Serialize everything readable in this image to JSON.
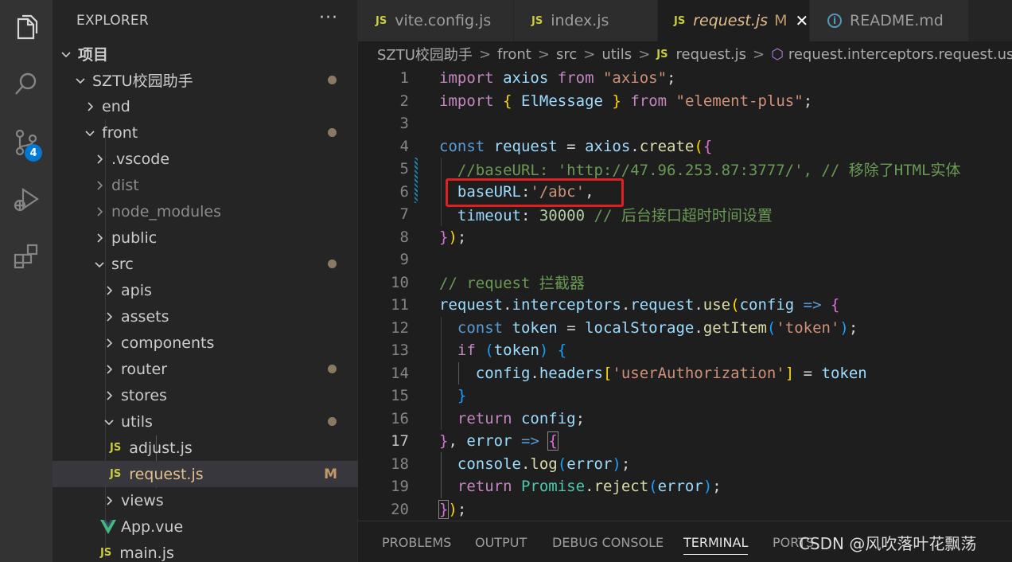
{
  "activity_bar": {
    "items": [
      {
        "icon": "files-icon"
      },
      {
        "icon": "search-icon"
      },
      {
        "icon": "source-control-icon",
        "badge": "4"
      },
      {
        "icon": "run-debug-icon"
      },
      {
        "icon": "extensions-icon"
      }
    ]
  },
  "sidebar": {
    "title": "EXPLORER",
    "more": "···",
    "tree": [
      {
        "label": "项目",
        "bold": true
      },
      {
        "label": "SZTU校园助手"
      },
      {
        "label": "end"
      },
      {
        "label": "front"
      },
      {
        "label": ".vscode"
      },
      {
        "label": "dist"
      },
      {
        "label": "node_modules"
      },
      {
        "label": "public"
      },
      {
        "label": "src"
      },
      {
        "label": "apis"
      },
      {
        "label": "assets"
      },
      {
        "label": "components"
      },
      {
        "label": "router"
      },
      {
        "label": "stores"
      },
      {
        "label": "utils"
      },
      {
        "label": "adjust.js"
      },
      {
        "label": "request.js",
        "status": "M"
      },
      {
        "label": "views"
      },
      {
        "label": "App.vue"
      },
      {
        "label": "main.js"
      }
    ],
    "js_badge": "JS"
  },
  "tabs": [
    {
      "label": "vite.config.js",
      "icon": "JS"
    },
    {
      "label": "index.js",
      "icon": "JS"
    },
    {
      "label": "request.js",
      "icon": "JS",
      "status": "M",
      "close": "✕"
    },
    {
      "label": "README.md",
      "icon": "i"
    }
  ],
  "breadcrumb": {
    "items": [
      "SZTU校园助手",
      "front",
      "src",
      "utils",
      "request.js",
      "request.interceptors.request.use() ca"
    ],
    "js": "JS"
  },
  "editor": {
    "current_line": 17,
    "line_numbers": [
      "1",
      "2",
      "3",
      "4",
      "5",
      "6",
      "7",
      "8",
      "9",
      "10",
      "11",
      "12",
      "13",
      "14",
      "15",
      "16",
      "17",
      "18",
      "19",
      "20"
    ]
  },
  "panel": {
    "tabs": [
      "PROBLEMS",
      "OUTPUT",
      "DEBUG CONSOLE",
      "TERMINAL",
      "PORTS"
    ],
    "active": "TERMINAL"
  },
  "watermark": "CSDN @风吹落叶花飘荡",
  "colors": {
    "highlight_box": "#e02020",
    "badge": "#0078d4"
  }
}
